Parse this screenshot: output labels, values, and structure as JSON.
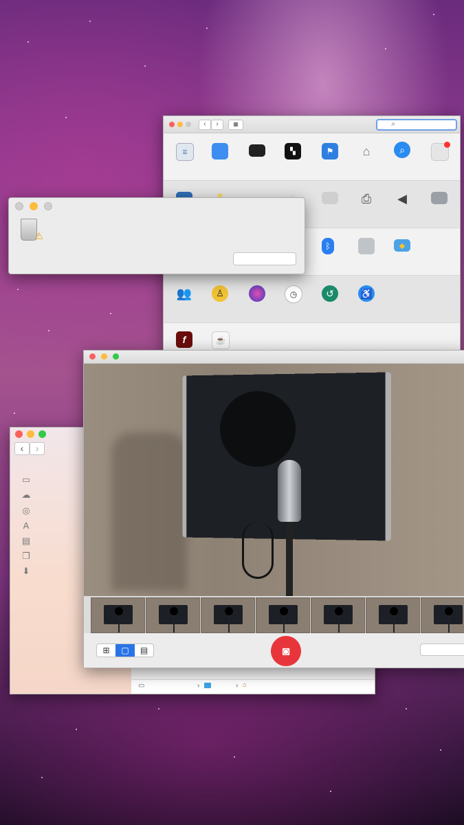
{
  "desktop": {
    "wallpaper": "purple galaxy"
  },
  "system_preferences": {
    "search": {
      "placeholder": "",
      "value": ""
    },
    "rows": [
      [
        "file-new-one-icon",
        "displays-blue-icon",
        "mission-control-icon",
        "desktop-screensaver-icon",
        "language-flag-icon",
        "security-house-icon",
        "spotlight-search-icon",
        "notifications-icon"
      ],
      [
        "display-monitor-icon",
        "energy-bulb-icon",
        "keyboard-icon",
        "trackpad-icon",
        "printer-icon",
        "sound-speaker-icon",
        "startup-disk-icon"
      ],
      [
        "bluetooth-icon",
        "extensions-icon",
        "sharing-folder-icon"
      ],
      [
        "users-groups-icon",
        "parental-controls-icon",
        "siri-icon",
        "date-time-icon",
        "time-machine-icon",
        "accessibility-icon"
      ],
      [
        "flash-player-icon",
        "java-icon"
      ]
    ]
  },
  "alert_dialog": {
    "icon": "trash-warning-icon",
    "button_label": ""
  },
  "finder": {
    "sidebar_icons": [
      "drive-icon",
      "icloud-icon",
      "airdrop-icon",
      "applications-icon",
      "desktop-icon",
      "documents-icon",
      "downloads-icon"
    ],
    "path_icons": [
      "hard-drive-icon",
      "folder-icon",
      "home-icon"
    ]
  },
  "photo_booth": {
    "view_modes": [
      "grid-view",
      "single-view",
      "filmstrip-view"
    ],
    "selected_view": "single-view",
    "thumbnail_count": 7,
    "effects_button_label": "",
    "colors": {
      "shutter": "#e8353c",
      "view_selected": "#2a74e6"
    }
  }
}
